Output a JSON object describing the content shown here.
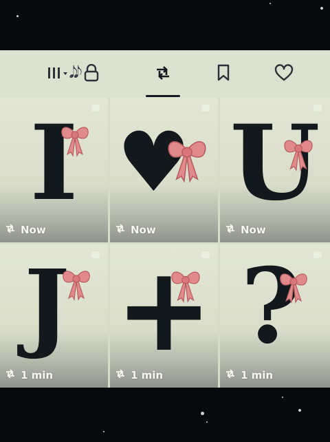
{
  "tabs": {
    "playlist_icon": "playlist-icon",
    "music_notes": "𝅘𝅥𝅮𝅘𝅥𝅮",
    "lock_icon": "lock-icon",
    "repost_icon": "repost-icon",
    "bookmark_icon": "bookmark-icon",
    "heart_icon": "heart-icon",
    "active_tab": "repost"
  },
  "grid": {
    "items": [
      {
        "glyph": "I",
        "time": "Now"
      },
      {
        "glyph": "♥",
        "time": "Now"
      },
      {
        "glyph": "U",
        "time": "Now"
      },
      {
        "glyph": "J",
        "time": "1 min"
      },
      {
        "glyph": "+",
        "time": "1 min"
      },
      {
        "glyph": "?",
        "time": "1 min"
      }
    ]
  },
  "colors": {
    "panel": "#d7dcc9",
    "glyph": "#12181b",
    "bow": "#e08a8c",
    "background": "#07090d"
  }
}
